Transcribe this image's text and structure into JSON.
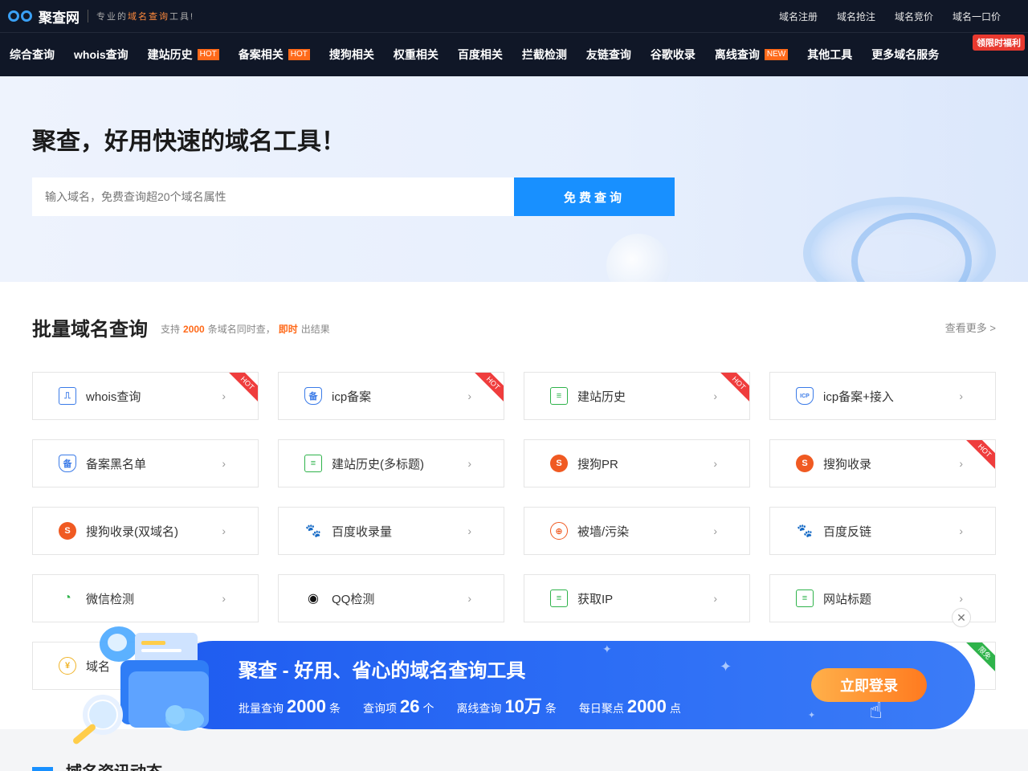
{
  "header": {
    "logo_text": "聚查网",
    "slogan_pre": "专业的",
    "slogan_em": "域名查询",
    "slogan_post": "工具!",
    "top_links": [
      "域名注册",
      "域名抢注",
      "域名竞价",
      "域名一口价"
    ]
  },
  "nav": {
    "items": [
      {
        "label": "综合查询",
        "tag": ""
      },
      {
        "label": "whois查询",
        "tag": ""
      },
      {
        "label": "建站历史",
        "tag": "HOT"
      },
      {
        "label": "备案相关",
        "tag": "HOT"
      },
      {
        "label": "搜狗相关",
        "tag": ""
      },
      {
        "label": "权重相关",
        "tag": ""
      },
      {
        "label": "百度相关",
        "tag": ""
      },
      {
        "label": "拦截检测",
        "tag": ""
      },
      {
        "label": "友链查询",
        "tag": ""
      },
      {
        "label": "谷歌收录",
        "tag": ""
      },
      {
        "label": "离线查询",
        "tag": "NEW"
      },
      {
        "label": "其他工具",
        "tag": ""
      },
      {
        "label": "更多域名服务",
        "tag": ""
      }
    ],
    "promo": "领限时福利"
  },
  "hero": {
    "title": "聚查，好用快速的域名工具！",
    "search_placeholder": "输入域名，免费查询超20个域名属性",
    "search_button": "免费查询"
  },
  "batch": {
    "title": "批量域名查询",
    "sub_pre": "支持",
    "sub_num": "2000",
    "sub_mid": "条域名同时查，",
    "sub_em": "即时",
    "sub_post": "出结果",
    "more": "查看更多 >",
    "cards": [
      {
        "label": "whois查询",
        "icon": "monitor-icon",
        "badge": "HOT"
      },
      {
        "label": "icp备案",
        "icon": "shield-icon",
        "badge": "HOT"
      },
      {
        "label": "建站历史",
        "icon": "history-icon",
        "badge": "HOT"
      },
      {
        "label": "icp备案+接入",
        "icon": "icp-shield-icon",
        "badge": ""
      },
      {
        "label": "备案黑名单",
        "icon": "shield-icon",
        "badge": ""
      },
      {
        "label": "建站历史(多标题)",
        "icon": "history-icon",
        "badge": ""
      },
      {
        "label": "搜狗PR",
        "icon": "sogou-icon",
        "badge": ""
      },
      {
        "label": "搜狗收录",
        "icon": "sogou-icon",
        "badge": "HOT"
      },
      {
        "label": "搜狗收录(双域名)",
        "icon": "sogou-icon",
        "badge": ""
      },
      {
        "label": "百度收录量",
        "icon": "baidu-icon",
        "badge": ""
      },
      {
        "label": "被墙/污染",
        "icon": "globe-icon",
        "badge": ""
      },
      {
        "label": "百度反链",
        "icon": "baidu-icon",
        "badge": ""
      },
      {
        "label": "微信检测",
        "icon": "wechat-icon",
        "badge": ""
      },
      {
        "label": "QQ检测",
        "icon": "qq-icon",
        "badge": ""
      },
      {
        "label": "获取IP",
        "icon": "history-icon",
        "badge": ""
      },
      {
        "label": "网站标题",
        "icon": "history-icon",
        "badge": ""
      },
      {
        "label": "域名",
        "icon": "coin-icon",
        "badge": ""
      },
      {
        "label": "",
        "icon": "",
        "badge": ""
      },
      {
        "label": "",
        "icon": "",
        "badge": ""
      },
      {
        "label": "",
        "icon": "",
        "badge": "限免"
      }
    ]
  },
  "banner": {
    "title": "聚查 - 好用、省心的域名查询工具",
    "stats": [
      {
        "pre": "批量查询",
        "num": "2000",
        "post": "条"
      },
      {
        "pre": "查询项",
        "num": "26",
        "post": "个"
      },
      {
        "pre": "离线查询",
        "num": "10万",
        "post": "条"
      },
      {
        "pre": "每日聚点",
        "num": "2000",
        "post": "点"
      }
    ],
    "button": "立即登录",
    "close": "✕"
  },
  "bottom": {
    "title": "域名资讯动态"
  },
  "colors": {
    "nav_bg": "#101727",
    "accent": "#1890ff",
    "hot": "#ff6a1a",
    "ribbon_red": "#ef3d3d",
    "ribbon_green": "#2fb34b"
  }
}
